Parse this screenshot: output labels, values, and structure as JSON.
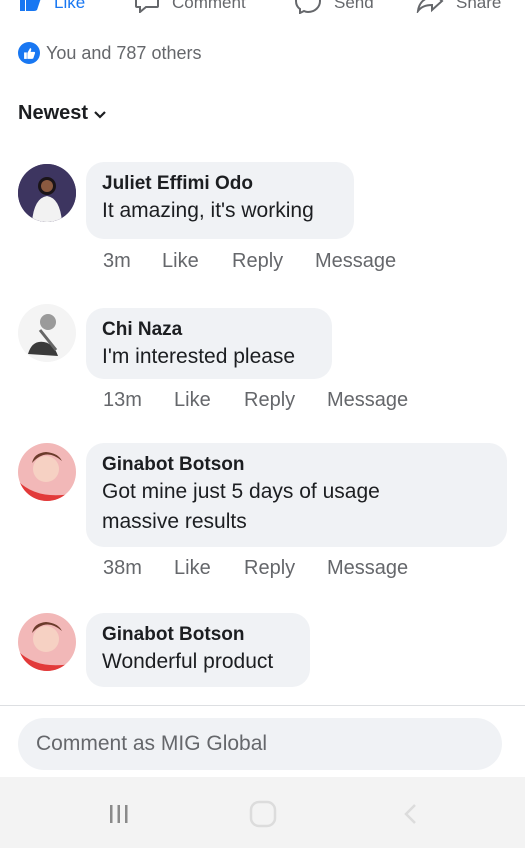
{
  "post_actions": {
    "like_label": "Like",
    "comment_label": "Comment",
    "send_label": "Send",
    "share_label": "Share"
  },
  "reactions": {
    "summary": "You and 787 others"
  },
  "sort": {
    "label": "Newest"
  },
  "comments": [
    {
      "author": "Juliet Effimi Odo",
      "text": "It amazing, it's working",
      "time": "3m",
      "like": "Like",
      "reply": "Reply",
      "message": "Message"
    },
    {
      "author": "Chi Naza",
      "text": "I'm interested please",
      "time": "13m",
      "like": "Like",
      "reply": "Reply",
      "message": "Message"
    },
    {
      "author": "Ginabot Botson",
      "text_line1": "Got mine just 5 days of usage",
      "text_line2": "massive results",
      "time": "38m",
      "like": "Like",
      "reply": "Reply",
      "message": "Message"
    },
    {
      "author": "Ginabot Botson",
      "text": "Wonderful product"
    }
  ],
  "composer": {
    "placeholder": "Comment as MIG Global"
  },
  "colors": {
    "brand_blue": "#1877f2",
    "bubble_bg": "#f0f2f5",
    "meta_gray": "#65676b"
  }
}
